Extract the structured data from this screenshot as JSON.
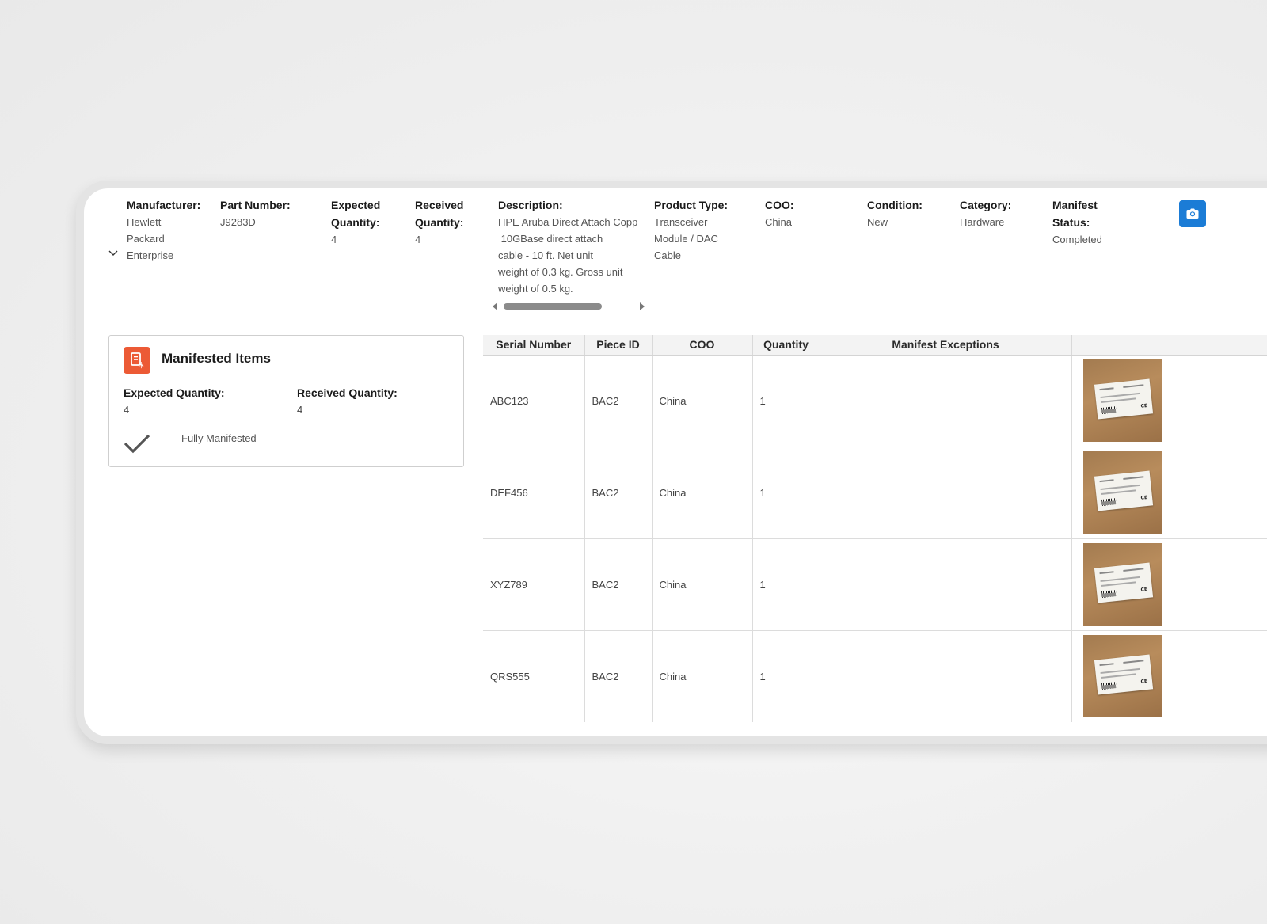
{
  "header": {
    "fields": [
      {
        "label": "Manufacturer:",
        "value_lines": [
          "Hewlett",
          "Packard",
          "Enterprise"
        ]
      },
      {
        "label": "Part Number:",
        "value_lines": [
          "J9283D"
        ]
      },
      {
        "label_lines": [
          "Expected",
          "Quantity:"
        ],
        "value_lines": [
          "4"
        ]
      },
      {
        "label_lines": [
          "Received",
          "Quantity:"
        ],
        "value_lines": [
          "4"
        ]
      },
      {
        "label": "Description:",
        "value_lines": [
          "HPE Aruba Direct Attach Copp",
          " 10GBase direct attach",
          "cable - 10 ft. Net unit",
          "weight of 0.3 kg. Gross unit",
          "weight of 0.5 kg."
        ]
      },
      {
        "label": "Product Type:",
        "value_lines": [
          "Transceiver",
          "Module / DAC",
          "Cable"
        ]
      },
      {
        "label": "COO:",
        "value_lines": [
          "China"
        ]
      },
      {
        "label": "Condition:",
        "value_lines": [
          "New"
        ]
      },
      {
        "label": "Category:",
        "value_lines": [
          "Hardware"
        ]
      },
      {
        "label_lines": [
          "Manifest",
          "Status:"
        ],
        "value_lines": [
          "Completed"
        ]
      }
    ],
    "icons": {
      "expand": "chevron-down-icon",
      "camera": "camera-icon"
    },
    "accent_color": "#1b7cd6"
  },
  "manifested_items": {
    "title": "Manifested Items",
    "icon": "document-dollar-icon",
    "icon_color": "#ec5a35",
    "expected_label": "Expected Quantity:",
    "expected_value": "4",
    "received_label": "Received Quantity:",
    "received_value": "4",
    "status_icon": "checkmark-icon",
    "status_text": "Fully Manifested"
  },
  "table": {
    "columns": [
      "Serial Number",
      "Piece ID",
      "COO",
      "Quantity",
      "Manifest Exceptions",
      ""
    ],
    "rows": [
      {
        "serial": "ABC123",
        "piece_id": "BAC2",
        "coo": "China",
        "quantity": "1",
        "exceptions": "",
        "photo": "package-photo"
      },
      {
        "serial": "DEF456",
        "piece_id": "BAC2",
        "coo": "China",
        "quantity": "1",
        "exceptions": "",
        "photo": "package-photo"
      },
      {
        "serial": "XYZ789",
        "piece_id": "BAC2",
        "coo": "China",
        "quantity": "1",
        "exceptions": "",
        "photo": "package-photo"
      },
      {
        "serial": "QRS555",
        "piece_id": "BAC2",
        "coo": "China",
        "quantity": "1",
        "exceptions": "",
        "photo": "package-photo"
      }
    ]
  }
}
